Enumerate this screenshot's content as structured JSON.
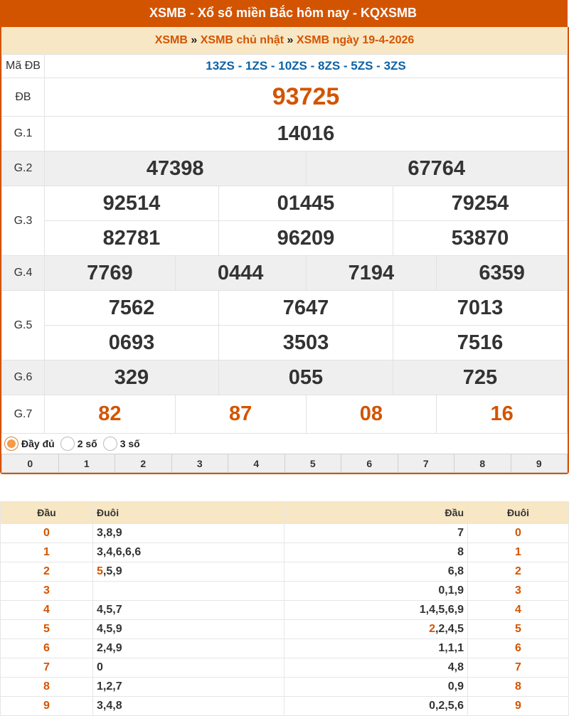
{
  "header": {
    "title": "XSMB - Xổ số miền Bắc hôm nay - KQXSMB"
  },
  "breadcrumb": {
    "items": [
      "XSMB",
      "XSMB chủ nhật",
      "XSMB ngày 19-4-2026"
    ],
    "sep": "»"
  },
  "results": {
    "madb_label": "Mã ĐB",
    "madb_value": "13ZS - 1ZS - 10ZS - 8ZS - 5ZS - 3ZS",
    "db_label": "ĐB",
    "db": "93725",
    "g1_label": "G.1",
    "g1": [
      "14016"
    ],
    "g2_label": "G.2",
    "g2": [
      "47398",
      "67764"
    ],
    "g3_label": "G.3",
    "g3": [
      "92514",
      "01445",
      "79254",
      "82781",
      "96209",
      "53870"
    ],
    "g4_label": "G.4",
    "g4": [
      "7769",
      "0444",
      "7194",
      "6359"
    ],
    "g5_label": "G.5",
    "g5": [
      "7562",
      "7647",
      "7013",
      "0693",
      "3503",
      "7516"
    ],
    "g6_label": "G.6",
    "g6": [
      "329",
      "055",
      "725"
    ],
    "g7_label": "G.7",
    "g7": [
      "82",
      "87",
      "08",
      "16"
    ]
  },
  "options": {
    "full": "Đầy đủ",
    "two": "2 số",
    "three": "3 số"
  },
  "digits": [
    "0",
    "1",
    "2",
    "3",
    "4",
    "5",
    "6",
    "7",
    "8",
    "9"
  ],
  "loto": {
    "headers": {
      "dau": "Đầu",
      "duoi": "Đuôi"
    },
    "left": [
      {
        "dau": "0",
        "hl": "",
        "rest": "3,8,9"
      },
      {
        "dau": "1",
        "hl": "",
        "rest": "3,4,6,6,6"
      },
      {
        "dau": "2",
        "hl": "5",
        "rest": ",5,9"
      },
      {
        "dau": "3",
        "hl": "",
        "rest": ""
      },
      {
        "dau": "4",
        "hl": "",
        "rest": "4,5,7"
      },
      {
        "dau": "5",
        "hl": "",
        "rest": "4,5,9"
      },
      {
        "dau": "6",
        "hl": "",
        "rest": "2,4,9"
      },
      {
        "dau": "7",
        "hl": "",
        "rest": "0"
      },
      {
        "dau": "8",
        "hl": "",
        "rest": "1,2,7"
      },
      {
        "dau": "9",
        "hl": "",
        "rest": "3,4,8"
      }
    ],
    "right": [
      {
        "hl": "",
        "rest": "7",
        "duoi": "0"
      },
      {
        "hl": "",
        "rest": "8",
        "duoi": "1"
      },
      {
        "hl": "",
        "rest": "6,8",
        "duoi": "2"
      },
      {
        "hl": "",
        "rest": "0,1,9",
        "duoi": "3"
      },
      {
        "hl": "",
        "rest": "1,4,5,6,9",
        "duoi": "4"
      },
      {
        "hl": "2",
        "rest": ",2,4,5",
        "duoi": "5"
      },
      {
        "hl": "",
        "rest": "1,1,1",
        "duoi": "6"
      },
      {
        "hl": "",
        "rest": "4,8",
        "duoi": "7"
      },
      {
        "hl": "",
        "rest": "0,9",
        "duoi": "8"
      },
      {
        "hl": "",
        "rest": "0,2,5,6",
        "duoi": "9"
      }
    ]
  },
  "colors": {
    "accent": "#d35400",
    "header_bg": "#f8e7c4",
    "madb": "#0b62a8"
  }
}
